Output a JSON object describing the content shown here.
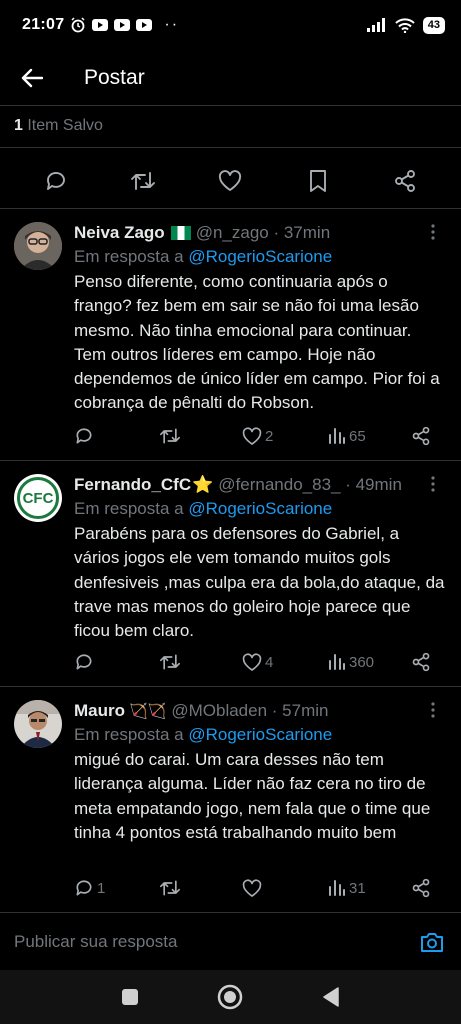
{
  "status_bar": {
    "time": "21:07",
    "dots": "··",
    "battery": "43"
  },
  "header": {
    "title": "Postar"
  },
  "saved": {
    "count": "1",
    "label": " Item Salvo"
  },
  "compose": {
    "placeholder": "Publicar sua resposta"
  },
  "replies": [
    {
      "name": "Neiva Zago",
      "handle": "@n_zago · 37min",
      "reply_prefix": "Em resposta a ",
      "reply_to": "@RogerioScarione",
      "text": "Penso diferente, como continuaria após o frango? fez bem em sair se não foi uma lesão mesmo. Não tinha emocional para continuar. Tem outros líderes em campo. Hoje não dependemos de único líder em campo. Pior foi a cobrança de pênalti do Robson.",
      "replies": "",
      "retweets": "",
      "likes": "2",
      "views": "65"
    },
    {
      "name": "Fernando_CfC",
      "name_emoji": "⭐",
      "handle": "@fernando_83_ · 49min",
      "reply_prefix": "Em resposta a ",
      "reply_to": "@RogerioScarione",
      "text": "Parabéns para os defensores do Gabriel, a vários jogos ele vem tomando muitos gols denfesiveis ,mas culpa era da bola,do ataque, da trave mas menos do goleiro hoje parece que ficou bem claro.",
      "avatar_text": "CFC",
      "replies": "",
      "retweets": "",
      "likes": "4",
      "views": "360"
    },
    {
      "name": "Mauro",
      "name_emoji": "🏹🏹",
      "handle": "@MObladen · 57min",
      "reply_prefix": "Em resposta a ",
      "reply_to": "@RogerioScarione",
      "text": "migué do carai. Um cara desses não tem liderança alguma. Líder não faz cera no tiro de meta empatando jogo, nem fala que o time que tinha 4 pontos está trabalhando muito bem",
      "replies": "1",
      "retweets": "",
      "likes": "",
      "views": "31"
    }
  ],
  "colors": {
    "background": "#000000",
    "text": "#e7e9ea",
    "muted": "#71767b",
    "accent": "#1d9bf0",
    "divider": "#2f3336"
  }
}
